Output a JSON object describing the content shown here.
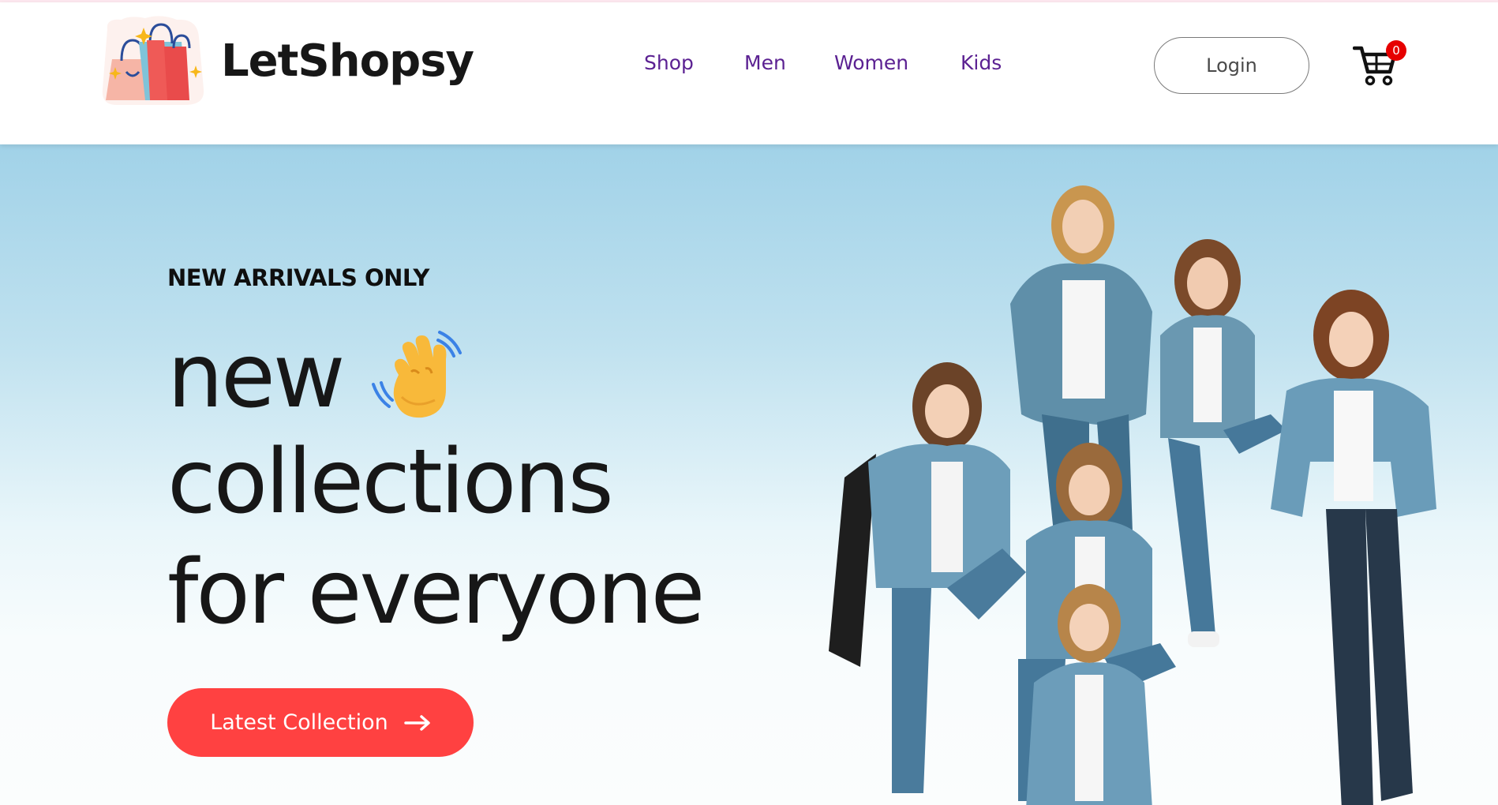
{
  "brand": {
    "name": "LetShopsy"
  },
  "nav": {
    "items": [
      {
        "label": "Shop"
      },
      {
        "label": "Men"
      },
      {
        "label": "Women"
      },
      {
        "label": "Kids"
      }
    ]
  },
  "header": {
    "login_label": "Login",
    "cart_count": "0"
  },
  "hero": {
    "kicker": "NEW ARRIVALS ONLY",
    "headline_line1": "new",
    "headline_line2": "collections",
    "headline_line3": "for everyone",
    "cta_label": "Latest Collection"
  },
  "colors": {
    "nav_text": "#5b2192",
    "cta_background": "#ff4141",
    "cart_badge": "#e60000",
    "hero_gradient_top": "#a1d2e8",
    "hero_gradient_bottom": "#fbfdfd"
  },
  "icons": {
    "logo": "shopping-bags-icon",
    "cart": "shopping-cart-icon",
    "wave": "waving-hand-icon",
    "arrow": "arrow-right-icon"
  }
}
